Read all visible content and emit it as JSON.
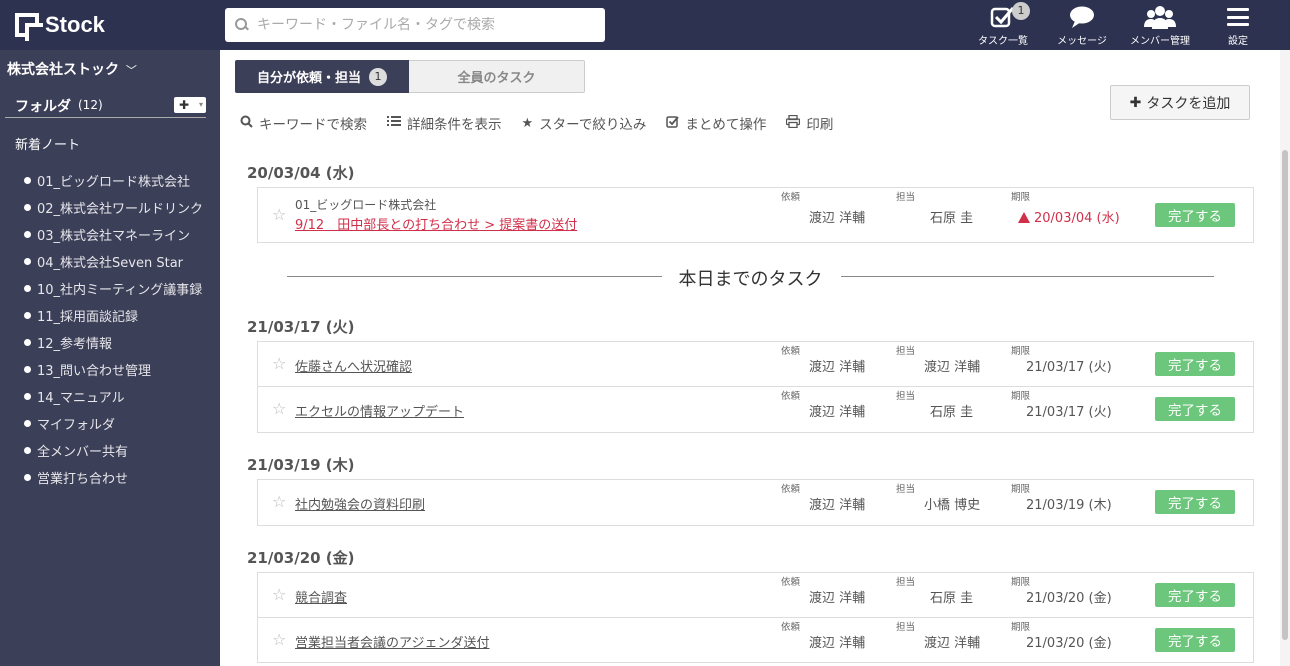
{
  "app": {
    "name": "Stock"
  },
  "search": {
    "placeholder": "キーワード・ファイル名・タグで検索"
  },
  "header_nav": [
    {
      "label": "タスク一覧",
      "badge": "1",
      "icon": "task-check-icon"
    },
    {
      "label": "メッセージ",
      "icon": "chat-bubble-icon"
    },
    {
      "label": "メンバー管理",
      "icon": "members-icon"
    },
    {
      "label": "設定",
      "icon": "hamburger-menu-icon"
    }
  ],
  "sidebar": {
    "company": "株式会社ストック",
    "folder_label": "フォルダ",
    "folder_count": "(12)",
    "new_note": "新着ノート",
    "folders": [
      "01_ビッグロード株式会社",
      "02_株式会社ワールドリンク",
      "03_株式会社マネーライン",
      "04_株式会社Seven Star",
      "10_社内ミーティング議事録",
      "11_採用面談記録",
      "12_参考情報",
      "13_問い合わせ管理",
      "14_マニュアル",
      "マイフォルダ",
      "全メンバー共有",
      "営業打ち合わせ"
    ]
  },
  "tabs": {
    "mine": "自分が依頼・担当",
    "mine_count": "1",
    "all": "全員のタスク"
  },
  "toolbar": [
    {
      "label": "キーワードで検索",
      "icon": "search-icon"
    },
    {
      "label": "詳細条件を表示",
      "icon": "list-icon"
    },
    {
      "label": "スターで絞り込み",
      "icon": "star-icon"
    },
    {
      "label": "まとめて操作",
      "icon": "checkbox-icon"
    },
    {
      "label": "印刷",
      "icon": "print-icon"
    }
  ],
  "add_task": "タスクを追加",
  "labels": {
    "requester": "依頼",
    "assignee": "担当",
    "due": "期限",
    "done": "完了する"
  },
  "divider": "本日までのタスク",
  "groups": [
    {
      "date": "20/03/04 (水)",
      "tasks": [
        {
          "folder": "01_ビッグロード株式会社",
          "title": "9/12　田中部長との打ち合わせ > 提案書の送付",
          "requester": "渡辺 洋輔",
          "assignee": "石原 圭",
          "due": "20/03/04 (水)",
          "overdue": true
        }
      ]
    },
    {
      "date": "21/03/17 (火)",
      "tasks": [
        {
          "title": "佐藤さんへ状況確認",
          "requester": "渡辺 洋輔",
          "assignee": "渡辺 洋輔",
          "due": "21/03/17 (火)"
        },
        {
          "title": "エクセルの情報アップデート",
          "requester": "渡辺 洋輔",
          "assignee": "石原 圭",
          "due": "21/03/17 (火)"
        }
      ]
    },
    {
      "date": "21/03/19 (木)",
      "tasks": [
        {
          "title": "社内勉強会の資料印刷",
          "requester": "渡辺 洋輔",
          "assignee": "小橋 博史",
          "due": "21/03/19 (木)"
        }
      ]
    },
    {
      "date": "21/03/20 (金)",
      "tasks": [
        {
          "title": "競合調査",
          "requester": "渡辺 洋輔",
          "assignee": "石原 圭",
          "due": "21/03/20 (金)"
        },
        {
          "title": "営業担当者会議のアジェンダ送付",
          "requester": "渡辺 洋輔",
          "assignee": "渡辺 洋輔",
          "due": "21/03/20 (金)"
        }
      ]
    }
  ]
}
